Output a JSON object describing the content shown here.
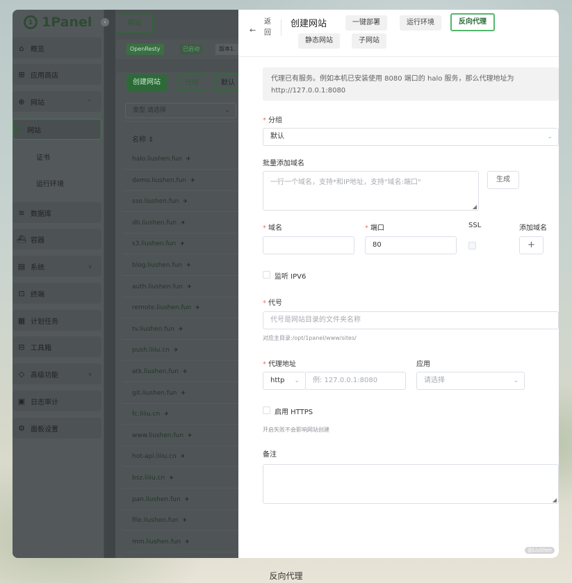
{
  "app": {
    "logo": "1Panel",
    "logo_glyph": "1"
  },
  "sidebar": {
    "items": [
      {
        "label": "概览",
        "icon": "home-icon",
        "glyph": "⌂"
      },
      {
        "label": "应用商店",
        "icon": "app-store-icon",
        "glyph": "⊞"
      },
      {
        "label": "网站",
        "icon": "globe-icon",
        "glyph": "⊕",
        "chevron": "^"
      },
      {
        "label": "网站"
      },
      {
        "label": "证书"
      },
      {
        "label": "运行环境"
      },
      {
        "label": "数据库",
        "icon": "database-icon",
        "glyph": "≋"
      },
      {
        "label": "容器",
        "icon": "container-icon",
        "glyph": "⛴"
      },
      {
        "label": "系统",
        "icon": "system-icon",
        "glyph": "▤",
        "chevron": "v"
      },
      {
        "label": "终端",
        "icon": "terminal-icon",
        "glyph": "⊡"
      },
      {
        "label": "计划任务",
        "icon": "calendar-icon",
        "glyph": "▦"
      },
      {
        "label": "工具箱",
        "icon": "toolbox-icon",
        "glyph": "⊟"
      },
      {
        "label": "高级功能",
        "icon": "diamond-icon",
        "glyph": "◇",
        "chevron": "v"
      },
      {
        "label": "日志审计",
        "icon": "log-icon",
        "glyph": "▣"
      },
      {
        "label": "面板设置",
        "icon": "settings-icon",
        "glyph": "⚙"
      }
    ]
  },
  "list": {
    "top_tab": "网站",
    "tags": [
      "OpenResty",
      "已启动",
      "版本1."
    ],
    "buttons": {
      "create": "创建网站",
      "group": "分组",
      "default": "默认"
    },
    "filter": "类型 请选择",
    "column": "名称 ⇕",
    "rows": [
      "halo.liushen.fun",
      "demo.liushen.fun",
      "sso.liushen.fun",
      "db.liushen.fun",
      "s3.liushen.fun",
      "blog.liushen.fun",
      "auth.liushen.fun",
      "remote.liushen.fun",
      "tv.liushen.fun",
      "push.liiiu.cn",
      "atk.liushen.fun",
      "git.liushen.fun",
      "fc.liiiu.cn",
      "www.liushen.fun",
      "hot-api.liiiu.cn",
      "bsz.liiiu.cn",
      "pan.liushen.fun",
      "file.liushen.fun",
      "mm.liushen.fun"
    ]
  },
  "drawer": {
    "back": "返回",
    "title": "创建网站",
    "tabs": [
      "一键部署",
      "运行环境",
      "反向代理",
      "静态网站",
      "子网站"
    ],
    "tip": "代理已有服务。例如本机已安装使用 8080 端口的 halo 服务，那么代理地址为 http://127.0.0.1:8080",
    "group_label": "分组",
    "group_value": "默认",
    "batch_label": "批量添加域名",
    "batch_placeholder": "一行一个域名，支持*和IP地址，支持\"域名:端口\"",
    "generate": "生成",
    "domain_label": "域名",
    "port_label": "端口",
    "port_value": "80",
    "ssl_label": "SSL",
    "add_domain_label": "添加域名",
    "add_glyph": "+",
    "ipv6": "监听 IPV6",
    "alias_label": "代号",
    "alias_placeholder": "代号是网站目录的文件夹名称",
    "alias_hint": "对应主目录:/opt/1panel/www/sites/",
    "proxy_label": "代理地址",
    "proxy_scheme": "http",
    "proxy_placeholder": "例: 127.0.0.1:8080",
    "app_label": "应用",
    "app_placeholder": "请选择",
    "https": "启用 HTTPS",
    "https_hint": "开启失败不会影响网站创建",
    "remark_label": "备注",
    "watermark": "@LiuShen"
  },
  "caption": "反向代理",
  "colors": {
    "accent": "#53b66a",
    "required": "#f56c6c"
  }
}
